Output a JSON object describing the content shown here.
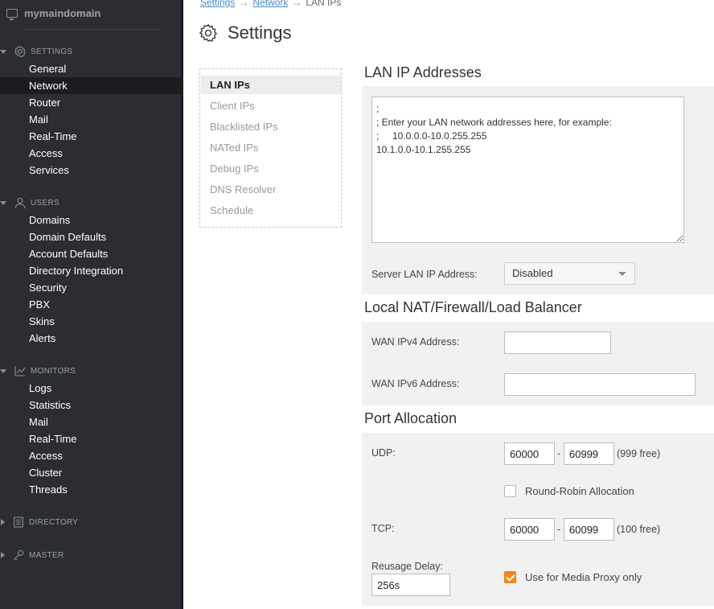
{
  "sidebar": {
    "domain": "mymaindomain",
    "sections": {
      "settings": "SETTINGS",
      "users": "USERS",
      "monitors": "MONITORS",
      "directory": "DIRECTORY",
      "master": "MASTER"
    },
    "settings_items": [
      "General",
      "Network",
      "Router",
      "Mail",
      "Real-Time",
      "Access",
      "Services"
    ],
    "users_items": [
      "Domains",
      "Domain Defaults",
      "Account Defaults",
      "Directory Integration",
      "Security",
      "PBX",
      "Skins",
      "Alerts"
    ],
    "monitors_items": [
      "Logs",
      "Statistics",
      "Mail",
      "Real-Time",
      "Access",
      "Cluster",
      "Threads"
    ],
    "active_item": "Network"
  },
  "breadcrumb": {
    "settings": "Settings",
    "network": "Network",
    "current": "LAN IPs",
    "arrow": "→"
  },
  "header": {
    "title": "Settings",
    "icon": "gear-icon"
  },
  "subnav": {
    "items": [
      "LAN IPs",
      "Client IPs",
      "Blacklisted IPs",
      "NATed IPs",
      "Debug IPs",
      "DNS Resolver",
      "Schedule"
    ],
    "active": "LAN IPs"
  },
  "lan": {
    "title": "LAN IP Addresses",
    "text": ";\n; Enter your LAN network addresses here, for example:\n;     10.0.0.0-10.0.255.255\n10.1.0.0-10.1.255.255",
    "server_label": "Server LAN IP Address:",
    "server_value": "Disabled"
  },
  "nat": {
    "title": "Local NAT/Firewall/Load Balancer",
    "wan4_label": "WAN IPv4 Address:",
    "wan4_value": "",
    "wan6_label": "WAN IPv6 Address:",
    "wan6_value": ""
  },
  "ports": {
    "title": "Port Allocation",
    "udp_label": "UDP:",
    "udp_from": "60000",
    "udp_to": "60999",
    "udp_free": "(999 free)",
    "round_robin_label": "Round-Robin Allocation",
    "round_robin_checked": false,
    "tcp_label": "TCP:",
    "tcp_from": "60000",
    "tcp_to": "60099",
    "tcp_free": "(100 free)",
    "reusage_label": "Reusage Delay:",
    "reusage_value": "256s",
    "media_proxy_label": "Use for Media Proxy only",
    "media_proxy_checked": true,
    "dash": "-"
  },
  "colors": {
    "sidebar_bg": "#2b2d33",
    "accent": "#f08a1c",
    "link": "#4a8ac4"
  }
}
